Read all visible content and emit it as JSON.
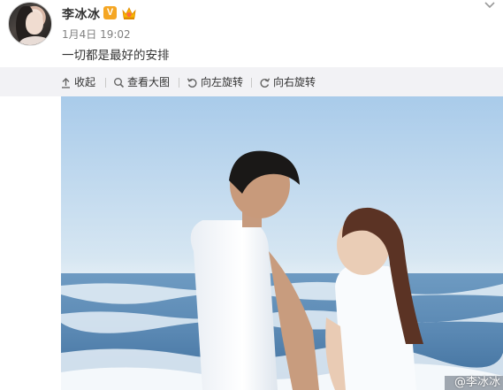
{
  "post": {
    "username": "李冰冰",
    "verified_badge": "V",
    "timestamp": "1月4日 19:02",
    "text": "一切都是最好的安排"
  },
  "toolbar": {
    "collapse_label": "收起",
    "view_large_label": "查看大图",
    "rotate_left_label": "向左旋转",
    "rotate_right_label": "向右旋转"
  },
  "photo": {
    "watermark": "@李冰冰"
  },
  "icons": {
    "menu": "chevron-down-icon",
    "collapse": "arrow-up-icon",
    "view_large": "magnifier-icon",
    "rotate_left": "rotate-left-icon",
    "rotate_right": "rotate-right-icon"
  },
  "colors": {
    "verified": "#f5a623",
    "toolbar_bg": "#f2f2f5",
    "text": "#333333",
    "muted": "#808080"
  }
}
